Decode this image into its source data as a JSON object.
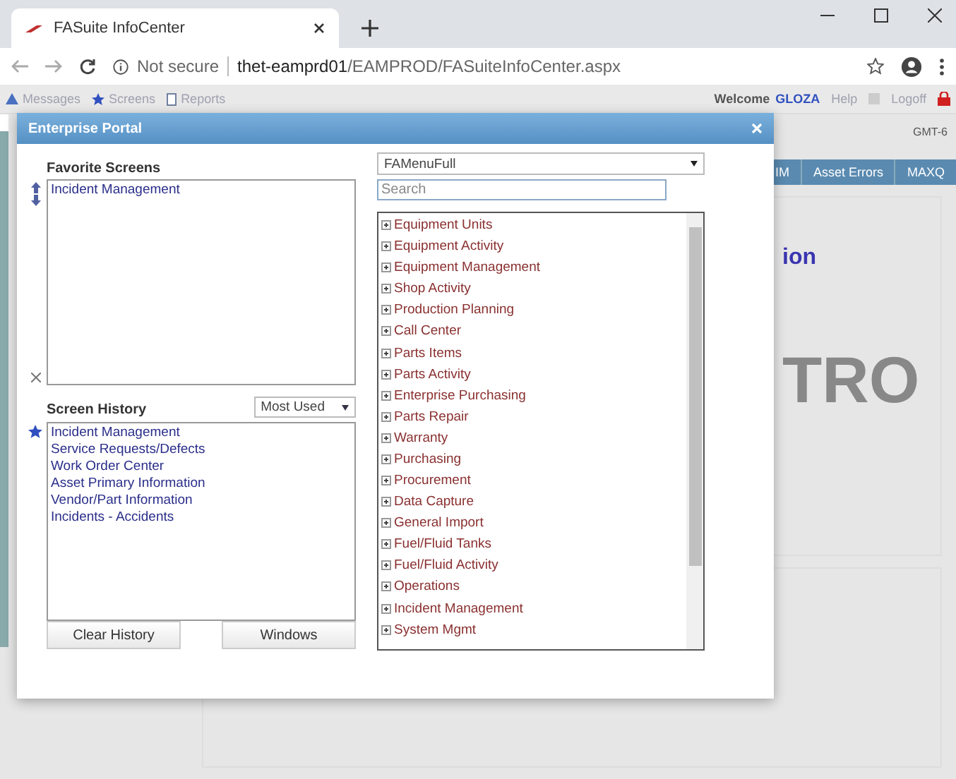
{
  "browser": {
    "tab_title": "FASuite InfoCenter",
    "security": "Not secure",
    "url_host": "thet-eamprd01",
    "url_path": "/EAMPROD/FASuiteInfoCenter.aspx"
  },
  "toolbar": {
    "items": [
      "Messages",
      "Screens",
      "Reports"
    ],
    "welcome": "Welcome",
    "user": "GLOZA",
    "help": "Help",
    "logoff": "Logoff",
    "timezone": "GMT-6"
  },
  "background": {
    "nav_items": [
      "IM",
      "Asset Errors",
      "MAXQ"
    ],
    "heading_fragment": "ion",
    "logo_fragment": "TRO"
  },
  "dialog": {
    "title": "Enterprise Portal",
    "favorites": {
      "label": "Favorite Screens",
      "items": [
        "Incident Management"
      ]
    },
    "history": {
      "label": "Screen History",
      "sort": "Most Used",
      "items": [
        "Incident Management",
        "Service Requests/Defects",
        "Work Order Center",
        "Asset Primary Information",
        "Vendor/Part Information",
        "Incidents - Accidents"
      ]
    },
    "buttons": [
      "Clear History",
      "Windows"
    ],
    "menu_select": "FAMenuFull",
    "search": {
      "placeholder": "Search"
    },
    "menu_items": [
      "Equipment Units",
      "Equipment Activity",
      "Equipment Management",
      "Shop Activity",
      "Production Planning",
      "Call Center",
      "Parts Items",
      "Parts Activity",
      "Enterprise Purchasing",
      "Parts Repair",
      "Warranty",
      "Purchasing",
      "Procurement",
      "Data Capture",
      "General Import",
      "Fuel/Fluid Tanks",
      "Fuel/Fluid Activity",
      "Operations",
      "Incident Management",
      "System Mgmt"
    ]
  }
}
